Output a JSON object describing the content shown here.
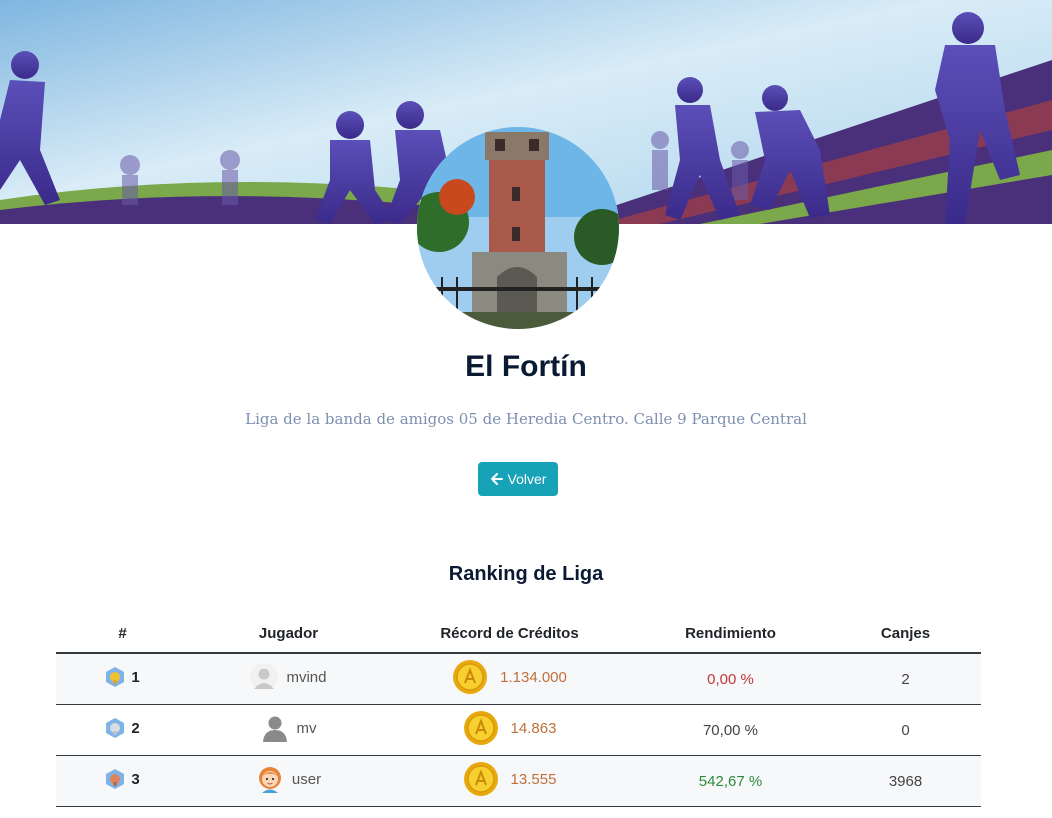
{
  "league": {
    "name": "El Fortín",
    "description": "Liga de la banda de amigos 05 de Heredia Centro. Calle 9 Parque Central"
  },
  "actions": {
    "back_label": "Volver",
    "back_icon": "arrow-left-icon"
  },
  "ranking": {
    "title": "Ranking de Liga",
    "columns": [
      "#",
      "Jugador",
      "Récord de Créditos",
      "Rendimiento",
      "Canjes"
    ],
    "rows": [
      {
        "position": "1",
        "medal": "gold-medal-icon",
        "player": "mvind",
        "avatar": "default-avatar-icon",
        "credits": "1.134.000",
        "performance": "0,00 %",
        "performance_status": "negative",
        "exchanges": "2"
      },
      {
        "position": "2",
        "medal": "silver-medal-icon",
        "player": "mv",
        "avatar": "silhouette-avatar-icon",
        "credits": "14.863",
        "performance": "70,00 %",
        "performance_status": "neutral",
        "exchanges": "0"
      },
      {
        "position": "3",
        "medal": "bronze-medal-icon",
        "player": "user",
        "avatar": "girl-avatar-icon",
        "credits": "13.555",
        "performance": "542,67 %",
        "performance_status": "positive",
        "exchanges": "3968"
      }
    ]
  },
  "colors": {
    "primary_button": "#17a2b8",
    "credits": "#c0703a",
    "negative": "#c0393b",
    "positive": "#2e8a3c"
  }
}
